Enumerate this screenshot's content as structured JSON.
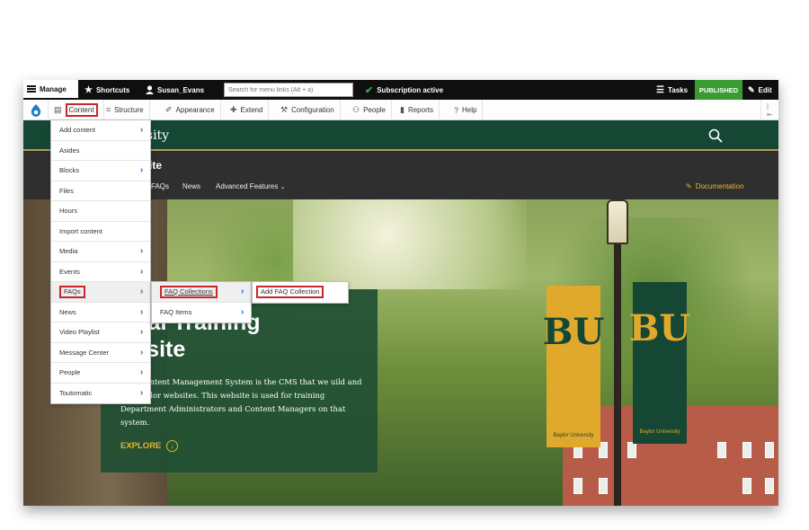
{
  "toolbar": {
    "manage": "Manage",
    "shortcuts": "Shortcuts",
    "user": "Susan_Evans",
    "search_placeholder": "Search for menu links (Alt + a)",
    "subscription": "Subscription active",
    "tasks": "Tasks",
    "published": "PUBLISHED",
    "edit": "Edit"
  },
  "adminbar": {
    "content": "Content",
    "structure": "Structure",
    "appearance": "Appearance",
    "extend": "Extend",
    "configuration": "Configuration",
    "people": "People",
    "reports": "Reports",
    "help": "Help"
  },
  "site": {
    "university": "versity",
    "title": "ite",
    "nav": [
      "FAQs",
      "News",
      "Advanced Features"
    ],
    "documentation": "Documentation"
  },
  "hero": {
    "heading_line1": "upal Training",
    "heading_line2": "ebsite",
    "paragraph": "upal Content Management System is the CMS that we uild and run Baylor websites.  This website is used for training Department Administrators and Content Managers on that system.",
    "explore": "EXPLORE",
    "banner_mark": "BU",
    "banner_label": "Baylor University"
  },
  "menus": {
    "content": [
      "Add content",
      "Asides",
      "Blocks",
      "Files",
      "Hours",
      "Import content",
      "Media",
      "Events",
      "FAQs",
      "News",
      "Video Playlist",
      "Message Center",
      "People",
      "Toutomatic"
    ],
    "faqs": [
      "FAQ Collections",
      "FAQ Items"
    ],
    "faq_collections": [
      "Add FAQ Collection"
    ]
  },
  "colors": {
    "baylor_green": "#154734",
    "baylor_gold": "#e1a92c",
    "highlight_red": "#c9262c",
    "published_green": "#3a9b33"
  }
}
